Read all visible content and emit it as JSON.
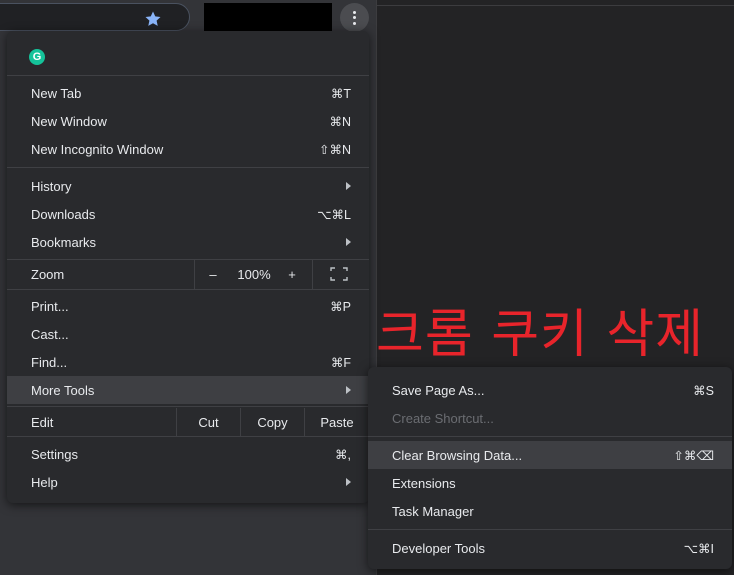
{
  "overlay_caption": "크롬 쿠키 삭제",
  "colors": {
    "caption": "#e8242b",
    "menu_bg": "#292a2d",
    "highlight": "#3e3f43",
    "accent_star": "#8ab4f8"
  },
  "icons": {
    "extension": "grammarly-icon",
    "bookmark": "star-icon",
    "menu": "kebab-icon",
    "fullscreen": "fullscreen-icon"
  },
  "extension_letter": "G",
  "menu": {
    "group1": [
      {
        "label": "New Tab",
        "shortcut": "⌘T"
      },
      {
        "label": "New Window",
        "shortcut": "⌘N"
      },
      {
        "label": "New Incognito Window",
        "shortcut": "⇧⌘N"
      }
    ],
    "group2": [
      {
        "label": "History",
        "shortcut": ""
      },
      {
        "label": "Downloads",
        "shortcut": "⌥⌘L"
      },
      {
        "label": "Bookmarks",
        "shortcut": ""
      }
    ],
    "zoom": {
      "label": "Zoom",
      "minus": "–",
      "value": "100%",
      "plus": "+"
    },
    "group3": [
      {
        "label": "Print...",
        "shortcut": "⌘P"
      },
      {
        "label": "Cast...",
        "shortcut": ""
      },
      {
        "label": "Find...",
        "shortcut": "⌘F"
      },
      {
        "label": "More Tools",
        "shortcut": ""
      }
    ],
    "edit": {
      "label": "Edit",
      "cut": "Cut",
      "copy": "Copy",
      "paste": "Paste"
    },
    "group4": [
      {
        "label": "Settings",
        "shortcut": "⌘,"
      },
      {
        "label": "Help",
        "shortcut": ""
      }
    ]
  },
  "more_tools": {
    "items": [
      {
        "label": "Save Page As...",
        "shortcut": "⌘S"
      },
      {
        "label": "Create Shortcut...",
        "shortcut": ""
      },
      {
        "label": "Clear Browsing Data...",
        "shortcut": "⇧⌘⌫"
      },
      {
        "label": "Extensions",
        "shortcut": ""
      },
      {
        "label": "Task Manager",
        "shortcut": ""
      },
      {
        "label": "Developer Tools",
        "shortcut": "⌥⌘I"
      }
    ]
  }
}
